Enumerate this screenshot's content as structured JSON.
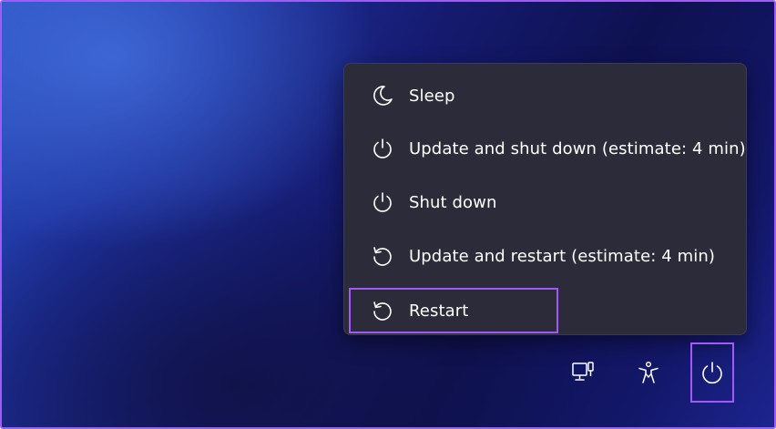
{
  "power_menu": {
    "items": [
      {
        "label": "Sleep",
        "icon": "moon-icon"
      },
      {
        "label": "Update and shut down (estimate: 4 min)",
        "icon": "power-icon"
      },
      {
        "label": "Shut down",
        "icon": "power-icon"
      },
      {
        "label": "Update and restart (estimate: 4 min)",
        "icon": "restart-icon"
      },
      {
        "label": "Restart",
        "icon": "restart-icon"
      }
    ],
    "highlighted_item": "Restart"
  },
  "tray": {
    "icons": [
      "network-icon",
      "accessibility-icon",
      "power-icon"
    ],
    "highlighted_icon": "power-icon"
  },
  "colors": {
    "highlight_outline": "#a259f7",
    "menu_background": "#2b2b3a",
    "text": "#ffffff"
  }
}
